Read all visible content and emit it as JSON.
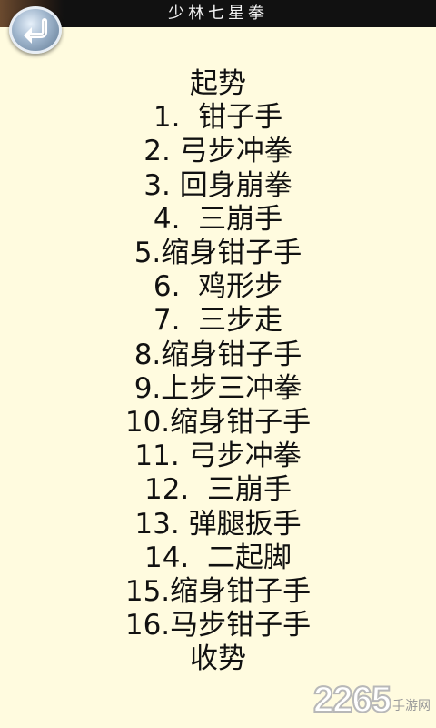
{
  "header": {
    "title": "少林七星拳"
  },
  "back_button": {
    "icon": "back-arrow-icon"
  },
  "moves": [
    "起势",
    "1.  钳子手",
    "2. 弓步冲拳",
    "3. 回身崩拳",
    "4.  三崩手",
    "5.缩身钳子手",
    "6.  鸡形步",
    "7.  三步走",
    "8.缩身钳子手",
    "9.上步三冲拳",
    "10.缩身钳子手",
    "11. 弓步冲拳",
    "12.  三崩手",
    "13. 弹腿扳手",
    "14.  二起脚",
    "15.缩身钳子手",
    "16.马步钳子手",
    "收势"
  ],
  "watermark": {
    "number": "2265",
    "text": "手游网"
  },
  "colors": {
    "background": "#FFFBDF",
    "titlebar": "#111111",
    "text": "#111111"
  }
}
